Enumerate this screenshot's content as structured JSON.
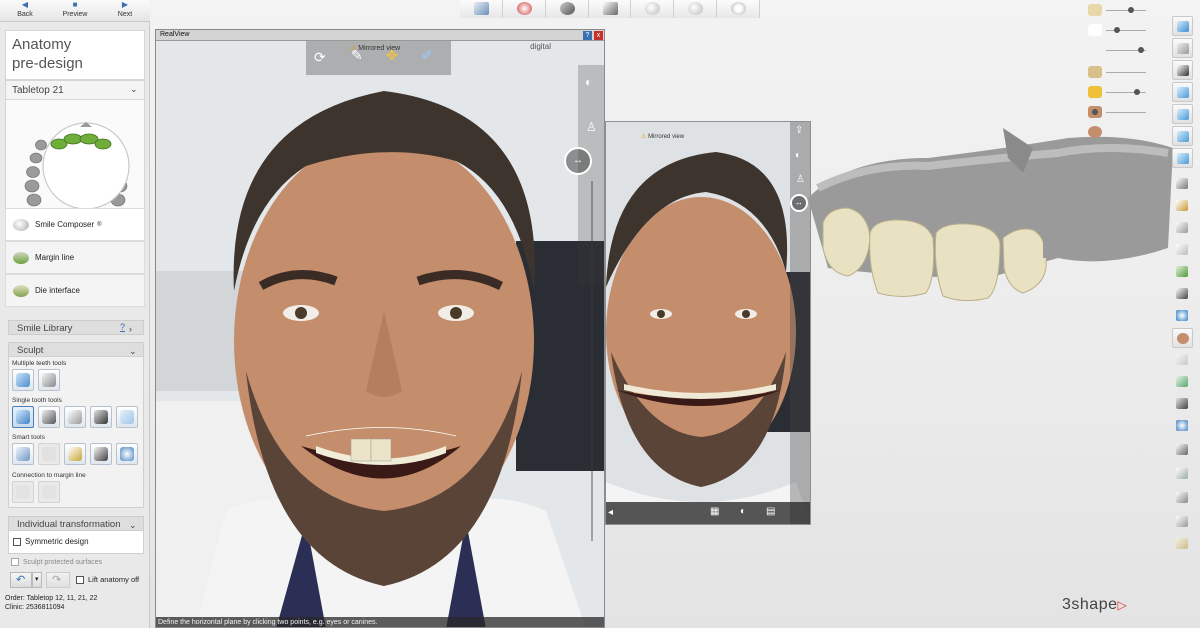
{
  "nav": {
    "back": "Back",
    "preview": "Preview",
    "next": "Next"
  },
  "panel": {
    "title_line1": "Anatomy",
    "title_line2": "pre-design",
    "tabletop": "Tabletop 21",
    "steps": [
      {
        "label": "Smile Composer",
        "sup": "®"
      },
      {
        "label": "Margin line"
      },
      {
        "label": "Die interface"
      }
    ],
    "smile_library": "Smile Library",
    "help_mark": "?",
    "sculpt": "Sculpt",
    "groups": {
      "multiple": "Multiple teeth tools",
      "single": "Single tooth tools",
      "smart": "Smart tools",
      "connection": "Connection to margin line"
    },
    "individual": "Individual transformation",
    "symmetric": "Symmetric design",
    "protected": "Sculpt protected surfaces",
    "lift": "Lift anatomy off",
    "order_line": "Order:  Tabletop 12, 11, 21, 22",
    "clinic_line": "Clinic:   2536811094"
  },
  "realview": {
    "title": "RealView",
    "warning": "Mirrored view",
    "brand": "digital",
    "close": "x",
    "help": "?",
    "status": "Define the horizontal plane by clicking two points, e.g. eyes or canines."
  },
  "realview2": {
    "warning": "Mirrored view"
  },
  "logo": {
    "name": "3shape",
    "mark": "▷"
  },
  "colors": {
    "accent": "#3a6fb0",
    "close": "#c9302c",
    "tooth": "#ece6c8",
    "gum": "#9a9a9a"
  }
}
